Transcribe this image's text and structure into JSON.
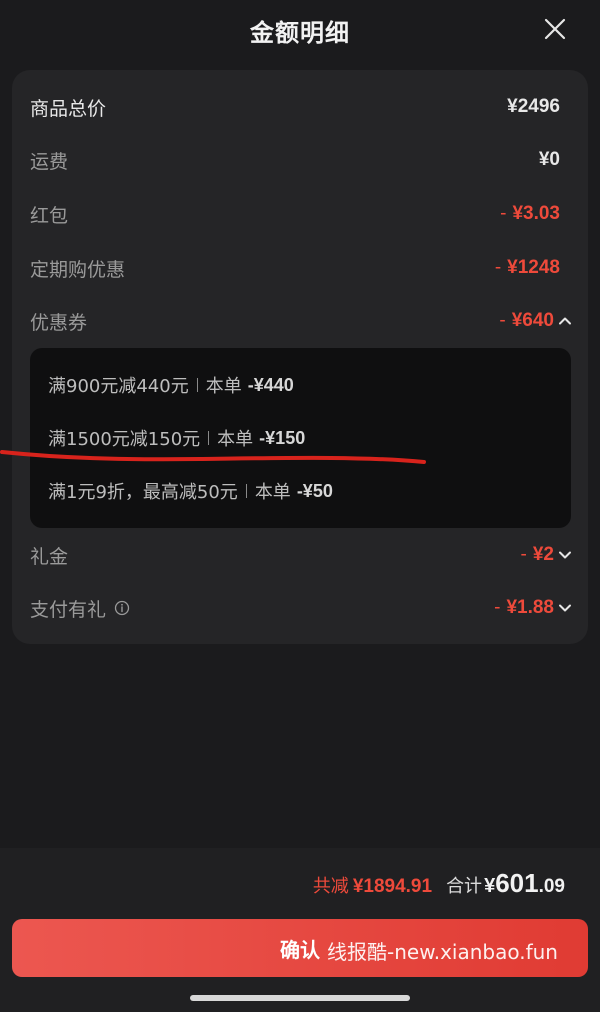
{
  "header": {
    "title": "金额明细"
  },
  "breakdown": {
    "goods_total": {
      "label": "商品总价",
      "value": "¥2496"
    },
    "shipping": {
      "label": "运费",
      "value": "¥0"
    },
    "red_packet": {
      "label": "红包",
      "minus": "-",
      "value": "¥3.03"
    },
    "subscription_discount": {
      "label": "定期购优惠",
      "minus": "-",
      "value": "¥1248"
    },
    "coupon": {
      "label": "优惠券",
      "minus": "-",
      "value": "¥640"
    },
    "gift_money": {
      "label": "礼金",
      "minus": "-",
      "value": "¥2"
    },
    "payment_gift": {
      "label": "支付有礼",
      "minus": "-",
      "value": "¥1.88"
    }
  },
  "coupons": [
    {
      "text": "满900元减440元",
      "order_label": "本单",
      "amount": "-¥440"
    },
    {
      "text": "满1500元减150元",
      "order_label": "本单",
      "amount": "-¥150"
    },
    {
      "text": "满1元9折，最高减50元",
      "order_label": "本单",
      "amount": "-¥50"
    }
  ],
  "summary": {
    "total_reduction_label": "共减",
    "total_reduction_value": "¥1894.91",
    "total_label": "合计",
    "total_currency": "¥",
    "total_int": "601",
    "total_dec": ".09"
  },
  "confirm": {
    "label": "确认",
    "watermark": "线报酷-new.xianbao.fun"
  },
  "colors": {
    "accent_red": "#ee4a3b",
    "button_red": "#e03b33",
    "background": "#1b1b1d",
    "card": "#252527"
  },
  "icons": {
    "close": "close-icon",
    "chevron_up": "chevron-up-icon",
    "chevron_down": "chevron-down-icon",
    "info": "info-icon"
  }
}
